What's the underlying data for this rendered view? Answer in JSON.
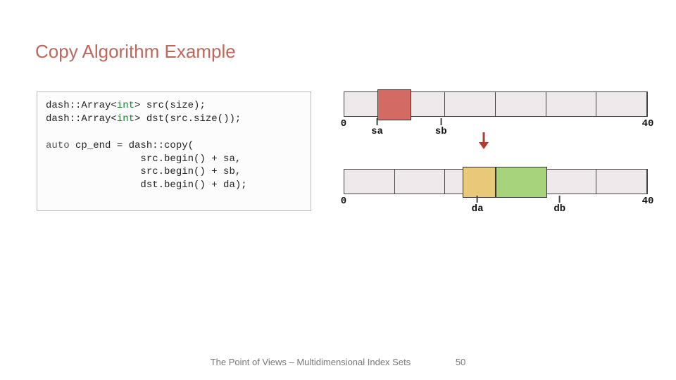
{
  "title": "Copy Algorithm Example",
  "code": {
    "l1a": "dash::Array<",
    "l1b": "int",
    "l1c": "> src(size);",
    "l2a": "dash::Array<",
    "l2b": "int",
    "l2c": "> dst(src.size());",
    "blank": " ",
    "l3a": "auto",
    "l3b": " cp_end = dash::copy(",
    "l4": "                src.begin() + sa,",
    "l5": "                src.begin() + sb,",
    "l6": "                dst.begin() + da);"
  },
  "src": {
    "cells": 6,
    "range_min": 0,
    "range_max": 40,
    "ticks": {
      "zero": "0",
      "sa": "sa",
      "sb": "sb",
      "max": "40"
    },
    "highlight": {
      "from_frac": 0.11,
      "to_frac": 0.22
    }
  },
  "dst": {
    "cells": 6,
    "range_min": 0,
    "range_max": 40,
    "ticks": {
      "zero": "0",
      "da": "da",
      "db": "db",
      "max": "40"
    },
    "highlight_tan": {
      "from_frac": 0.39,
      "to_frac": 0.5
    },
    "highlight_green": {
      "from_frac": 0.5,
      "to_frac": 0.67
    }
  },
  "footer": {
    "text": "The Point of Views – Multidimensional Index Sets",
    "page": "50"
  },
  "chart_data": {
    "type": "table",
    "description": "Two 1-D arrays of length 40 partitioned into 6 blocks. dash::copy moves the source slice [sa, sb) into the destination starting at da; the result ends at db.",
    "src_array": {
      "length": 40,
      "blocks": 6,
      "sa_approx": 4,
      "sb_approx": 9,
      "highlight": "red"
    },
    "dst_array": {
      "length": 40,
      "blocks": 6,
      "da_approx": 16,
      "db_approx": 27,
      "copied_region": [
        "tan",
        "green"
      ]
    },
    "arrow": "src slice -> dst[da]"
  }
}
